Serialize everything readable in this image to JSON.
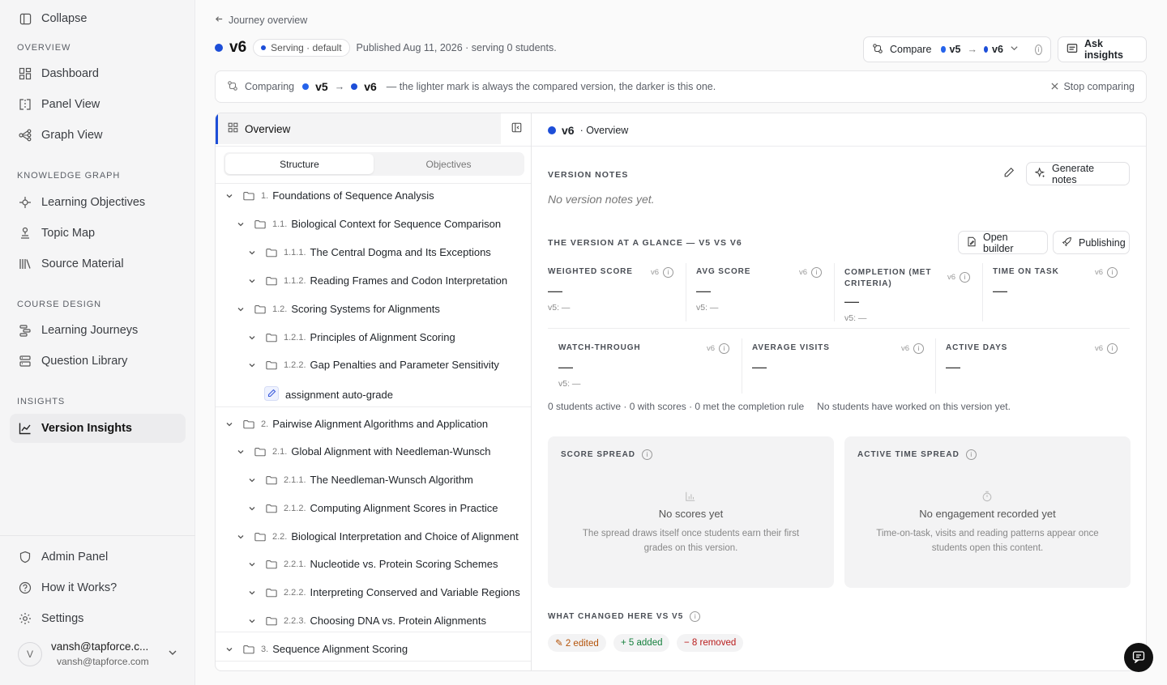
{
  "sidebar": {
    "collapse_label": "Collapse",
    "sections": {
      "overview": "OVERVIEW",
      "knowledge_graph": "KNOWLEDGE GRAPH",
      "course_design": "COURSE DESIGN",
      "insights": "INSIGHTS"
    },
    "items": {
      "dashboard": "Dashboard",
      "panel_view": "Panel View",
      "graph_view": "Graph View",
      "learning_objectives": "Learning Objectives",
      "topic_map": "Topic Map",
      "source_material": "Source Material",
      "learning_journeys": "Learning Journeys",
      "question_library": "Question Library",
      "version_insights": "Version Insights",
      "admin_panel": "Admin Panel",
      "how_it_works": "How it Works?",
      "settings": "Settings"
    },
    "user": {
      "avatar_letter": "V",
      "name": "vansh@tapforce.c...",
      "email": "vansh@tapforce.com"
    }
  },
  "header": {
    "back_label": "Journey overview",
    "version": "v6",
    "serving_pill": "Serving · default",
    "published_text": "Published Aug 11, 2026 · serving 0 students.",
    "compare_label": "Compare",
    "compare_from": "v5",
    "compare_arrow": "→",
    "compare_to": "v6",
    "ask_insights_label": "Ask insights"
  },
  "compare_bar": {
    "label": "Comparing",
    "from": "v5",
    "arrow": "→",
    "to": "v6",
    "description": "— the lighter mark is always the compared version, the darker is this one.",
    "stop_label": "Stop comparing"
  },
  "left_panel": {
    "title": "Overview",
    "tabs": [
      "Structure",
      "Objectives"
    ],
    "tree": [
      {
        "num": "1.",
        "label": "Foundations of Sequence Analysis"
      },
      {
        "num": "1.1.",
        "label": "Biological Context for Sequence Comparison"
      },
      {
        "num": "1.1.1.",
        "label": "The Central Dogma and Its Exceptions"
      },
      {
        "num": "1.1.2.",
        "label": "Reading Frames and Codon Interpretation"
      },
      {
        "num": "1.2.",
        "label": "Scoring Systems for Alignments"
      },
      {
        "num": "1.2.1.",
        "label": "Principles of Alignment Scoring"
      },
      {
        "num": "1.2.2.",
        "label": "Gap Penalties and Parameter Sensitivity"
      },
      {
        "num": "",
        "label": "assignment auto-grade"
      },
      {
        "num": "2.",
        "label": "Pairwise Alignment Algorithms and Application"
      },
      {
        "num": "2.1.",
        "label": "Global Alignment with Needleman-Wunsch"
      },
      {
        "num": "2.1.1.",
        "label": "The Needleman-Wunsch Algorithm"
      },
      {
        "num": "2.1.2.",
        "label": "Computing Alignment Scores in Practice"
      },
      {
        "num": "2.2.",
        "label": "Biological Interpretation and Choice of Alignment"
      },
      {
        "num": "2.2.1.",
        "label": "Nucleotide vs. Protein Scoring Schemes"
      },
      {
        "num": "2.2.2.",
        "label": "Interpreting Conserved and Variable Regions"
      },
      {
        "num": "2.2.3.",
        "label": "Choosing DNA vs. Protein Alignments"
      },
      {
        "num": "3.",
        "label": "Sequence Alignment Scoring"
      }
    ]
  },
  "right_panel": {
    "title_version": "v6",
    "title_suffix": "· Overview",
    "version_notes_label": "VERSION NOTES",
    "generate_notes_label": "Generate notes",
    "no_notes": "No version notes yet.",
    "glance_label": "THE VERSION AT A GLANCE — V5 VS V6",
    "open_builder_label": "Open builder",
    "publishing_label": "Publishing",
    "metrics": [
      {
        "name": "WEIGHTED SCORE",
        "tag": "v6",
        "value": "—",
        "sub": "v5: —"
      },
      {
        "name": "AVG SCORE",
        "tag": "v6",
        "value": "—",
        "sub": "v5: —"
      },
      {
        "name": "COMPLETION (MET CRITERIA)",
        "tag": "v6",
        "value": "—",
        "sub": "v5: —"
      },
      {
        "name": "TIME ON TASK",
        "tag": "v6",
        "value": "—",
        "sub": ""
      },
      {
        "name": "WATCH-THROUGH",
        "tag": "v6",
        "value": "—",
        "sub": "v5: —"
      },
      {
        "name": "AVERAGE VISITS",
        "tag": "v6",
        "value": "—",
        "sub": ""
      },
      {
        "name": "ACTIVE DAYS",
        "tag": "v6",
        "value": "—",
        "sub": ""
      }
    ],
    "activity_summary": "0 students active · 0 with scores · 0 met the completion rule",
    "activity_note": "No students have worked on this version yet.",
    "score_spread": {
      "label": "SCORE SPREAD",
      "empty_title": "No scores yet",
      "empty_text": "The spread draws itself once students earn their first grades on this version."
    },
    "time_spread": {
      "label": "ACTIVE TIME SPREAD",
      "empty_title": "No engagement recorded yet",
      "empty_text": "Time-on-task, visits and reading patterns appear once students open this content."
    },
    "changes_label": "WHAT CHANGED HERE VS V5",
    "badges": {
      "edited": "✎ 2 edited",
      "added": "+ 5 added",
      "removed": "− 8 removed"
    }
  },
  "colors": {
    "accent": "#1d4ed8",
    "edited": "#b45309",
    "added": "#15803d",
    "removed": "#b91c1c"
  }
}
